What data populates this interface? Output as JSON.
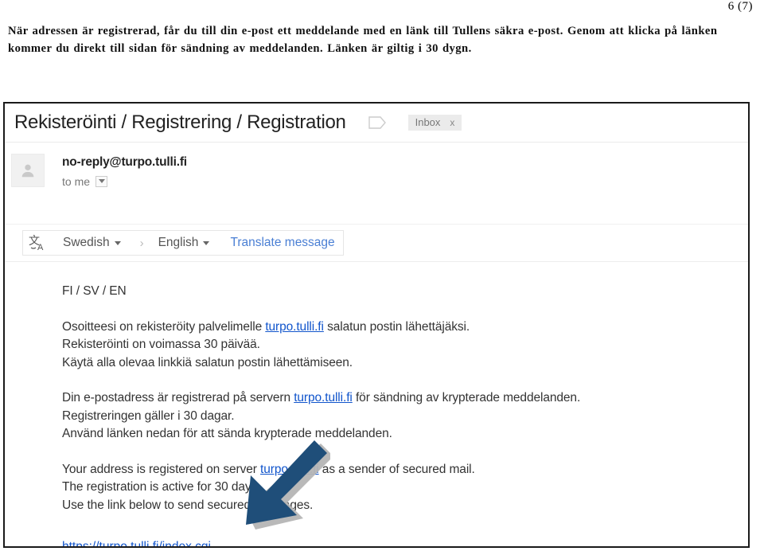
{
  "document": {
    "page_number": "6 (7)",
    "intro_paragraph": "När adressen är registrerad, får du till din e-post ett meddelande med en länk till Tullens säkra e-post. Genom att klicka på länken kommer du direkt till sidan för sändning av meddelanden. Länken är giltig i 30 dygn."
  },
  "email": {
    "subject": "Rekisteröinti / Registrering / Registration",
    "label_tag_icon": "label-tag-icon",
    "inbox_chip": {
      "label": "Inbox",
      "close": "x"
    },
    "avatar_icon": "person-avatar-icon",
    "sender_address": "no-reply@turpo.tulli.fi",
    "to_line": "to me",
    "to_caret_icon": "chevron-down-icon",
    "translate": {
      "icon": "google-translate-icon",
      "source_language": "Swedish",
      "arrow": "›",
      "target_language": "English",
      "action_label": "Translate message"
    },
    "body": {
      "languages_line": "FI / SV / EN",
      "fi": {
        "line1_before_link": "Osoitteesi on rekisteröity palvelimelle ",
        "line1_link": "turpo.tulli.fi",
        "line1_after_link": " salatun postin lähettäjäksi.",
        "line2": "Rekisteröinti on voimassa 30 päivää.",
        "line3": "Käytä alla olevaa linkkiä salatun postin lähettämiseen."
      },
      "sv": {
        "line1_before_link": "Din e-postadress är registrerad på servern ",
        "line1_link": "turpo.tulli.fi",
        "line1_after_link": " för sändning av krypterade meddelanden.",
        "line2": "Registreringen gäller i 30 dagar.",
        "line3": "Använd länken nedan för att sända krypterade meddelanden."
      },
      "en": {
        "line1_before_link": "Your address is registered on server ",
        "line1_link": "turpo.tulli.fi",
        "line1_after_link": " as a sender of secured mail.",
        "line2": "The registration is active for 30 days.",
        "line3": "Use the link below to send secured messages."
      },
      "final_link": "https://turpo.tulli.fi/index.cgi"
    }
  },
  "annotation": {
    "arrow_icon": "down-left-arrow-annotation",
    "arrow_color": "#1F4E79",
    "shadow_color": "#b0b0b0"
  },
  "colors": {
    "link": "#1155CC",
    "translate_action": "#4A7FD4",
    "chip_background": "#EBEBEB",
    "frame_border": "#1A1A1A"
  }
}
